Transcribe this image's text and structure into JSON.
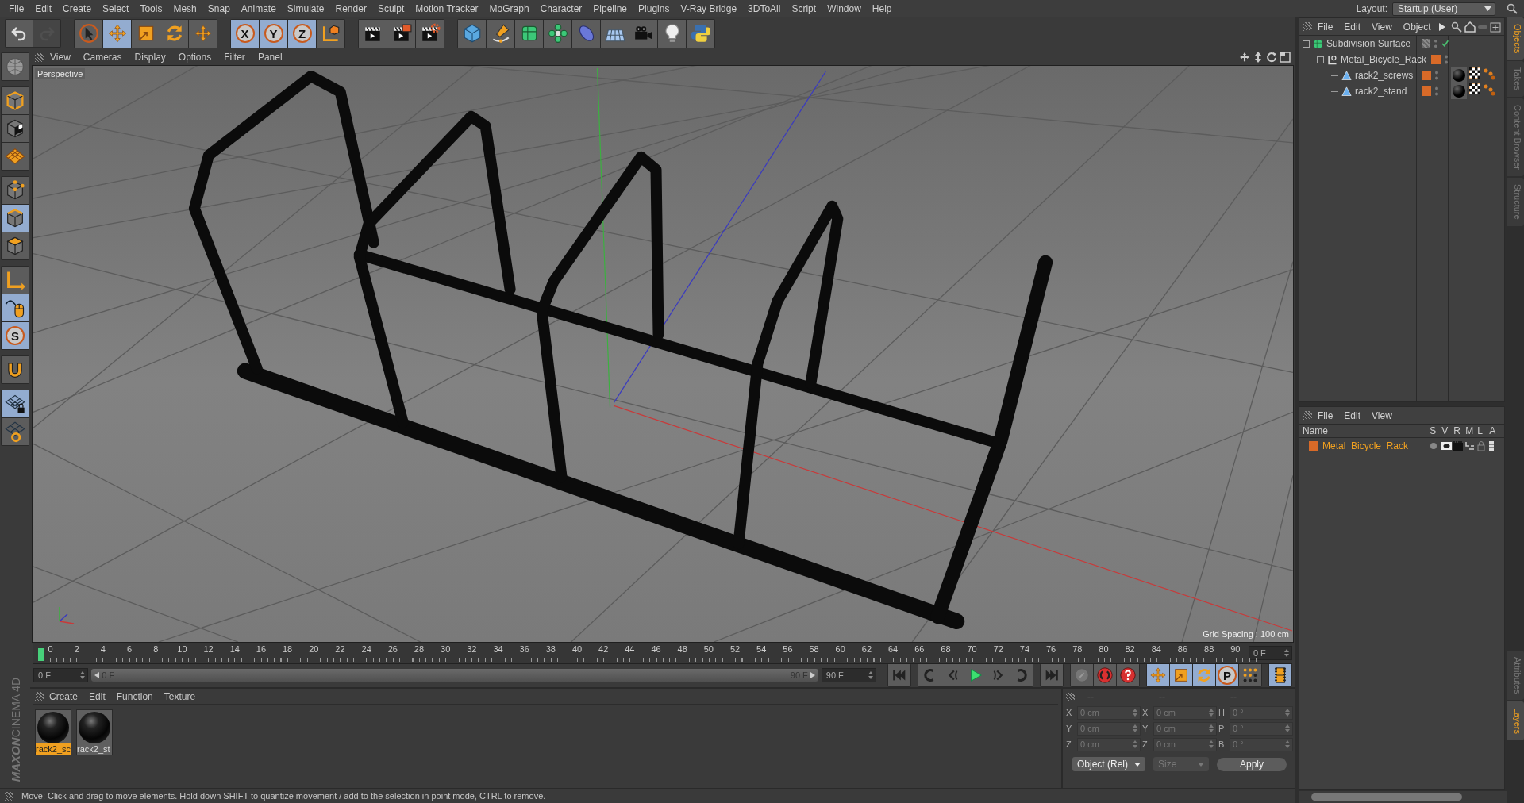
{
  "menu": [
    "File",
    "Edit",
    "Create",
    "Select",
    "Tools",
    "Mesh",
    "Snap",
    "Animate",
    "Simulate",
    "Render",
    "Sculpt",
    "Motion Tracker",
    "MoGraph",
    "Character",
    "Pipeline",
    "Plugins",
    "V-Ray Bridge",
    "3DToAll",
    "Script",
    "Window",
    "Help"
  ],
  "layout": {
    "label": "Layout:",
    "value": "Startup (User)"
  },
  "toolbar": {
    "history": [
      {
        "kind": "undo",
        "disabled": false
      },
      {
        "kind": "redo",
        "disabled": true
      }
    ],
    "groups": [
      [
        {
          "kind": "select",
          "selected": false
        },
        {
          "kind": "move",
          "selected": true
        },
        {
          "kind": "scale",
          "selected": false
        },
        {
          "kind": "rotate",
          "selected": false
        },
        {
          "kind": "transform",
          "selected": false
        }
      ],
      [
        {
          "kind": "axis",
          "label": "X",
          "selected": true
        },
        {
          "kind": "axis",
          "label": "Y",
          "selected": true
        },
        {
          "kind": "axis",
          "label": "Z",
          "selected": true
        },
        {
          "kind": "coordinate-system",
          "selected": false
        }
      ],
      [
        {
          "kind": "render-view",
          "selected": false
        },
        {
          "kind": "render-picture",
          "selected": false
        },
        {
          "kind": "render-settings",
          "selected": false
        }
      ],
      [
        {
          "kind": "cube",
          "selected": false
        },
        {
          "kind": "pen",
          "selected": false
        },
        {
          "kind": "subdivision",
          "selected": false
        },
        {
          "kind": "cloner",
          "selected": false
        },
        {
          "kind": "deformer",
          "selected": false
        },
        {
          "kind": "floor",
          "selected": false
        },
        {
          "kind": "camera",
          "selected": false
        },
        {
          "kind": "light",
          "selected": false
        },
        {
          "kind": "python",
          "selected": false
        }
      ]
    ]
  },
  "left_tools": [
    [
      {
        "kind": "make-editable",
        "selected": false
      }
    ],
    [
      {
        "kind": "model",
        "selected": false
      },
      {
        "kind": "texture",
        "selected": false
      },
      {
        "kind": "workplane",
        "selected": false
      }
    ],
    [
      {
        "kind": "points",
        "selected": false
      },
      {
        "kind": "edges",
        "selected": true
      },
      {
        "kind": "polygons",
        "selected": false
      }
    ],
    [
      {
        "kind": "axis-mode",
        "selected": false
      },
      {
        "kind": "tweak",
        "selected": true
      },
      {
        "kind": "solo",
        "label": "S",
        "selected": true
      }
    ],
    [
      {
        "kind": "snap",
        "selected": false
      }
    ],
    [
      {
        "kind": "lock-workplane",
        "selected": true
      },
      {
        "kind": "workplane-rotate",
        "selected": false
      }
    ]
  ],
  "brand": [
    "MAXON",
    "CINEMA 4D"
  ],
  "viewport": {
    "menu": [
      "View",
      "Cameras",
      "Display",
      "Options",
      "Filter",
      "Panel"
    ],
    "camera": "Perspective",
    "grid_spacing": "Grid Spacing : 100 cm"
  },
  "timeline": {
    "ticks": [
      "0",
      "2",
      "4",
      "6",
      "8",
      "10",
      "12",
      "14",
      "16",
      "18",
      "20",
      "22",
      "24",
      "26",
      "28",
      "30",
      "32",
      "34",
      "36",
      "38",
      "40",
      "42",
      "44",
      "46",
      "48",
      "50",
      "52",
      "54",
      "56",
      "58",
      "60",
      "62",
      "64",
      "66",
      "68",
      "70",
      "72",
      "74",
      "76",
      "78",
      "80",
      "82",
      "84",
      "86",
      "88",
      "90"
    ],
    "frame_field": "0 F",
    "start_field": "0 F",
    "range": {
      "start": "0 F",
      "end": "90 F",
      "level": 1
    },
    "end_field": "90 F"
  },
  "transport": [
    [
      {
        "kind": "first-frame",
        "selected": false
      }
    ],
    [
      {
        "kind": "previous-key",
        "selected": false
      },
      {
        "kind": "previous-frame",
        "selected": false
      },
      {
        "kind": "play",
        "selected": false
      },
      {
        "kind": "next-frame",
        "selected": false
      },
      {
        "kind": "next-key",
        "selected": false
      }
    ],
    [
      {
        "kind": "last-frame",
        "selected": false
      }
    ],
    [
      {
        "kind": "record-off",
        "selected": false
      },
      {
        "kind": "record",
        "selected": false
      },
      {
        "kind": "autokey",
        "selected": false
      }
    ],
    [
      {
        "kind": "key-move",
        "selected": true
      },
      {
        "kind": "key-scale",
        "selected": true
      },
      {
        "kind": "key-rotate",
        "selected": true
      },
      {
        "kind": "key-parameter",
        "label": "P",
        "selected": true
      },
      {
        "kind": "key-points",
        "selected": false
      }
    ],
    [
      {
        "kind": "timeline-film",
        "selected": true
      }
    ]
  ],
  "materials": {
    "menu": [
      "Create",
      "Edit",
      "Function",
      "Texture"
    ],
    "items": [
      {
        "name": "rack2_sc",
        "selected": true
      },
      {
        "name": "rack2_st",
        "selected": false
      }
    ]
  },
  "coordinates": {
    "headers": [
      "--",
      "--",
      "--"
    ],
    "rows": [
      [
        {
          "axis": "X",
          "value": "0 cm"
        },
        {
          "axis": "X",
          "value": "0 cm"
        },
        {
          "axis": "H",
          "value": "0 °"
        }
      ],
      [
        {
          "axis": "Y",
          "value": "0 cm"
        },
        {
          "axis": "Y",
          "value": "0 cm"
        },
        {
          "axis": "P",
          "value": "0 °"
        }
      ],
      [
        {
          "axis": "Z",
          "value": "0 cm"
        },
        {
          "axis": "Z",
          "value": "0 cm"
        },
        {
          "axis": "B",
          "value": "0 °"
        }
      ]
    ],
    "mode": {
      "value": "Object (Rel)",
      "disabled": false
    },
    "size": {
      "value": "Size",
      "disabled": true
    },
    "apply": "Apply"
  },
  "status": "Move: Click and drag to move elements. Hold down SHIFT to quantize movement / add to the selection in point mode, CTRL to remove.",
  "objects": {
    "menu": [
      "File",
      "Edit",
      "View",
      "Object"
    ],
    "tree": [
      {
        "name": "Subdivision Surface",
        "kind": "generator",
        "expanded": true,
        "enabled": true,
        "children": [
          {
            "name": "Metal_Bicycle_Rack",
            "kind": "null",
            "expanded": true,
            "enabled": false,
            "color": "#d86a28",
            "children": [
              {
                "name": "rack2_screws",
                "kind": "polygon",
                "enabled": false,
                "color": "#d86a28",
                "tags": [
                  {
                    "kind": "material"
                  },
                  {
                    "kind": "uvw"
                  },
                  {
                    "kind": "selection"
                  }
                ]
              },
              {
                "name": "rack2_stand",
                "kind": "polygon",
                "enabled": false,
                "color": "#d86a28",
                "tags": [
                  {
                    "kind": "material"
                  },
                  {
                    "kind": "uvw"
                  },
                  {
                    "kind": "selection"
                  }
                ]
              }
            ]
          }
        ]
      }
    ]
  },
  "side_tabs": [
    {
      "label": "Objects",
      "selected": true
    },
    {
      "label": "Takes",
      "selected": false
    },
    {
      "label": "Content Browser",
      "selected": false
    },
    {
      "label": "Structure",
      "selected": false
    }
  ],
  "side_tabs_lower": [
    {
      "label": "Attributes",
      "selected": false
    },
    {
      "label": "Layers",
      "selected": true
    }
  ],
  "layers": {
    "menu": [
      "File",
      "Edit",
      "View"
    ],
    "columns": [
      "Name",
      "S",
      "V",
      "R",
      "M",
      "L",
      "A"
    ],
    "rows": [
      {
        "name": "Metal_Bicycle_Rack",
        "color": "#d86a28"
      }
    ]
  }
}
